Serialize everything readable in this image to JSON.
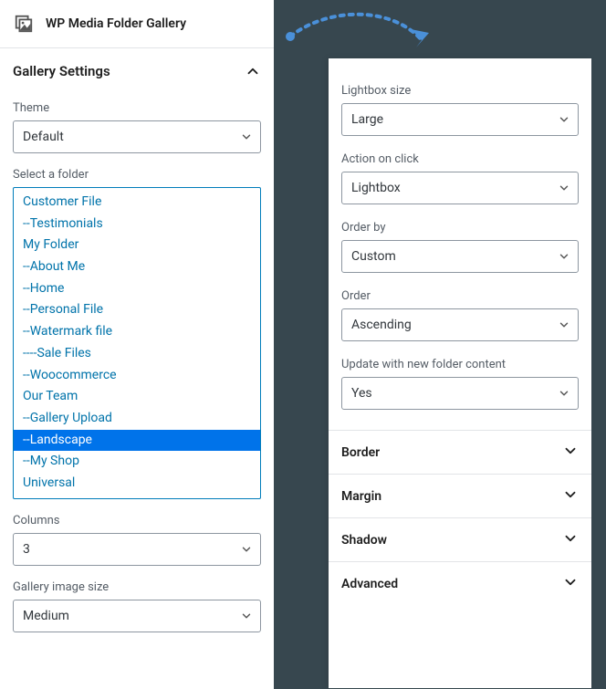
{
  "header": {
    "title": "WP Media Folder Gallery"
  },
  "section": {
    "title": "Gallery Settings"
  },
  "theme": {
    "label": "Theme",
    "value": "Default"
  },
  "folder": {
    "label": "Select a folder",
    "items": [
      "Customer File",
      "--Testimonials",
      "My Folder",
      "--About Me",
      "--Home",
      "--Personal File",
      "--Watermark file",
      "----Sale Files",
      "--Woocommerce",
      "Our Team",
      "--Gallery Upload",
      "--Landscape",
      "--My Shop",
      "Universal"
    ],
    "selected_index": 11
  },
  "columns": {
    "label": "Columns",
    "value": "3"
  },
  "image_size": {
    "label": "Gallery image size",
    "value": "Medium"
  },
  "right": {
    "lightbox_size": {
      "label": "Lightbox size",
      "value": "Large"
    },
    "action_click": {
      "label": "Action on click",
      "value": "Lightbox"
    },
    "order_by": {
      "label": "Order by",
      "value": "Custom"
    },
    "order": {
      "label": "Order",
      "value": "Ascending"
    },
    "update_folder": {
      "label": "Update with new folder content",
      "value": "Yes"
    }
  },
  "accordions": {
    "border": "Border",
    "margin": "Margin",
    "shadow": "Shadow",
    "advanced": "Advanced"
  }
}
